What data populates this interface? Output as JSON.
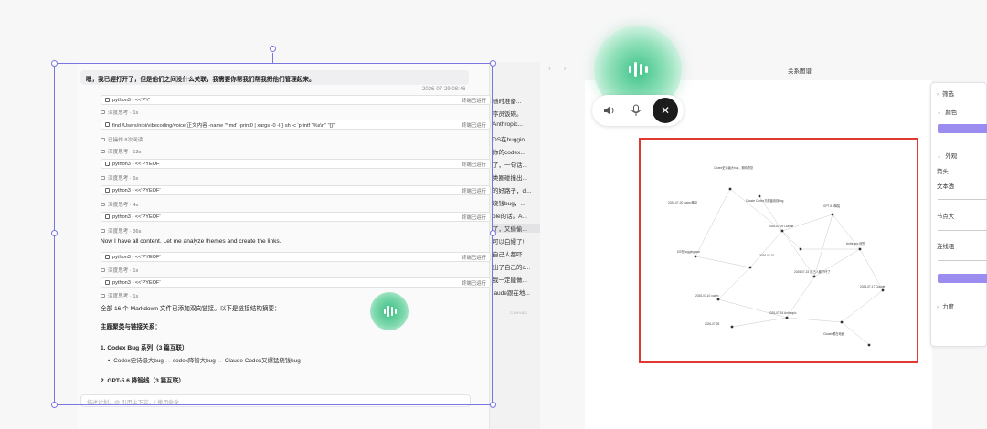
{
  "chat": {
    "top_message": "嗯，我已經打开了，但是他们之间没什么关联，我需要你帮我们帮我把他们管理起来。",
    "timestamp": "2026-07-29 08:46",
    "tool_calls": [
      {
        "cmd": "python3 - <<'PY'",
        "status": "終端已运行"
      },
      {
        "cmd": "find /Users/nipi/vibecoding/voice/正文内容 -name '*.md' -print0 | xargs -0 -I{} sh -c 'printf \"%s\\n\" \"{}\"'",
        "status": "終端已运行"
      },
      {
        "cmd": "python3 - <<'PYEOF'",
        "status": "終端已运行"
      },
      {
        "cmd": "python3 - <<'PYEOF'",
        "status": "終端已运行"
      },
      {
        "cmd": "python3 - <<'PYEOF'",
        "status": "終端已运行"
      },
      {
        "cmd": "python3 - <<'PYEOF'",
        "status": "終端已运行"
      },
      {
        "cmd": "python3 - <<'PYEOF'",
        "status": "終端已运行"
      }
    ],
    "think_lines": [
      "深度思考 · 1s",
      "深度思考 · 1s",
      "已操作 8次阅读",
      "深度思考 · 13s",
      "深度思考 · 6s",
      "深度思考 · 4s",
      "深度思考 · 36s",
      "深度思考 · 1s",
      "深度思考 · 1s"
    ],
    "analysis_line": "Now I have all content. Let me analyze themes and create the links.",
    "summary_line": "全部 16 个 Markdown 文件已添加双向链接。以下是链接结构摘要：",
    "section_title": "主题聚类与链接关系：",
    "group1_title": "1. Codex Bug 系列（3 篇互联）",
    "group1_item": "Codex史诗级大bug ↔ codex降智大bug ↔ Claude Codex又爆猛烧钱bug",
    "group2_title": "2. GPT-5.6 降智线（3 篇互联）",
    "input_placeholder": "描述计划、@ 引用上下文、/ 使用命令"
  },
  "strip": {
    "items": [
      "随时准备...",
      "序员饭碗。",
      "Anthropic...",
      "DS在huggin...",
      "你的codex...",
      "了，一句话...",
      "类圈碰撞出...",
      "的好路子，cl...",
      "烧钱bug，...",
      "ole的话。A...",
      "了，又偷偷...",
      "可以白嫖了!",
      "自己人都吓...",
      "出了自己的c...",
      "我一定能做...",
      "laude跟在地..."
    ],
    "footer": "CANVAS"
  },
  "graph": {
    "nav_arrows": "‹ ›",
    "title": "关系图谱",
    "node_labels": [
      "Codex史诗级大bug，期待修复",
      "2026-07-20 codex降智",
      "Claude Codex又爆猛烧钱bug",
      "GPT-5.6降智",
      "Anthropic 研究",
      "DS在huggingface",
      "2026-07-29 Claude",
      "2026-07-15 自己人都吓坏了",
      "2026-07-10 codex",
      "2026-07-18 Anthropic",
      "2026-07-28",
      "Claude跟在地面",
      "2026-07-17 Claude",
      "2026-07-01"
    ]
  },
  "side_panel": {
    "rows": [
      "筛选",
      "颜色",
      "外观",
      "箭头",
      "文本透",
      "节点大",
      "连线粗",
      "力度"
    ]
  },
  "controls": {
    "speaker_icon": "speaker-icon",
    "mic_icon": "microphone-icon",
    "close_icon": "close-icon"
  }
}
